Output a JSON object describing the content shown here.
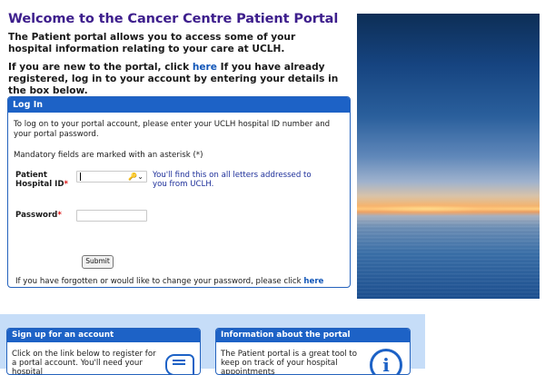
{
  "page": {
    "title": "Welcome to the Cancer Centre Patient Portal",
    "intro": "The Patient portal allows you to access some of your hospital information relating to your care at UCLH.",
    "new_prefix": "If you are new to the portal, click ",
    "new_link": "here",
    "new_suffix": " If you have already registered, log in to your account by entering your details in the box below."
  },
  "login": {
    "header": "Log In",
    "instructions": "To log on to your portal account, please enter your UCLH hospital ID number and your portal password.",
    "mandatory_note": "Mandatory fields are marked with an asterisk (*)",
    "hospital_id_label": "Patient Hospital ID",
    "hospital_id_value": "",
    "hospital_id_hint": "You'll find this on all letters addressed to you from UCLH.",
    "password_label": "Password",
    "password_value": "",
    "required_marker": "*",
    "submit_label": "Submit",
    "forgot_text": "If you have forgotten or would like to change your password, please click ",
    "forgot_link": "here"
  },
  "cards": {
    "signup": {
      "header": "Sign up for an account",
      "text": "Click on the link below to register for a portal account. You'll need your hospital"
    },
    "info": {
      "header": "Information about the portal",
      "text": "The Patient portal is a great tool to keep on track of your hospital appointments"
    }
  },
  "icons": {
    "key_autofill": "key-dropdown-icon",
    "signup": "handshake-icon",
    "info": "info-icon",
    "info_glyph": "i"
  },
  "colors": {
    "title": "#3d1e8c",
    "panel_header": "#1d62c6",
    "link": "#1156b8",
    "required": "#d11111",
    "hint": "#1d2f9a",
    "lower_band": "#c6ddf8"
  }
}
